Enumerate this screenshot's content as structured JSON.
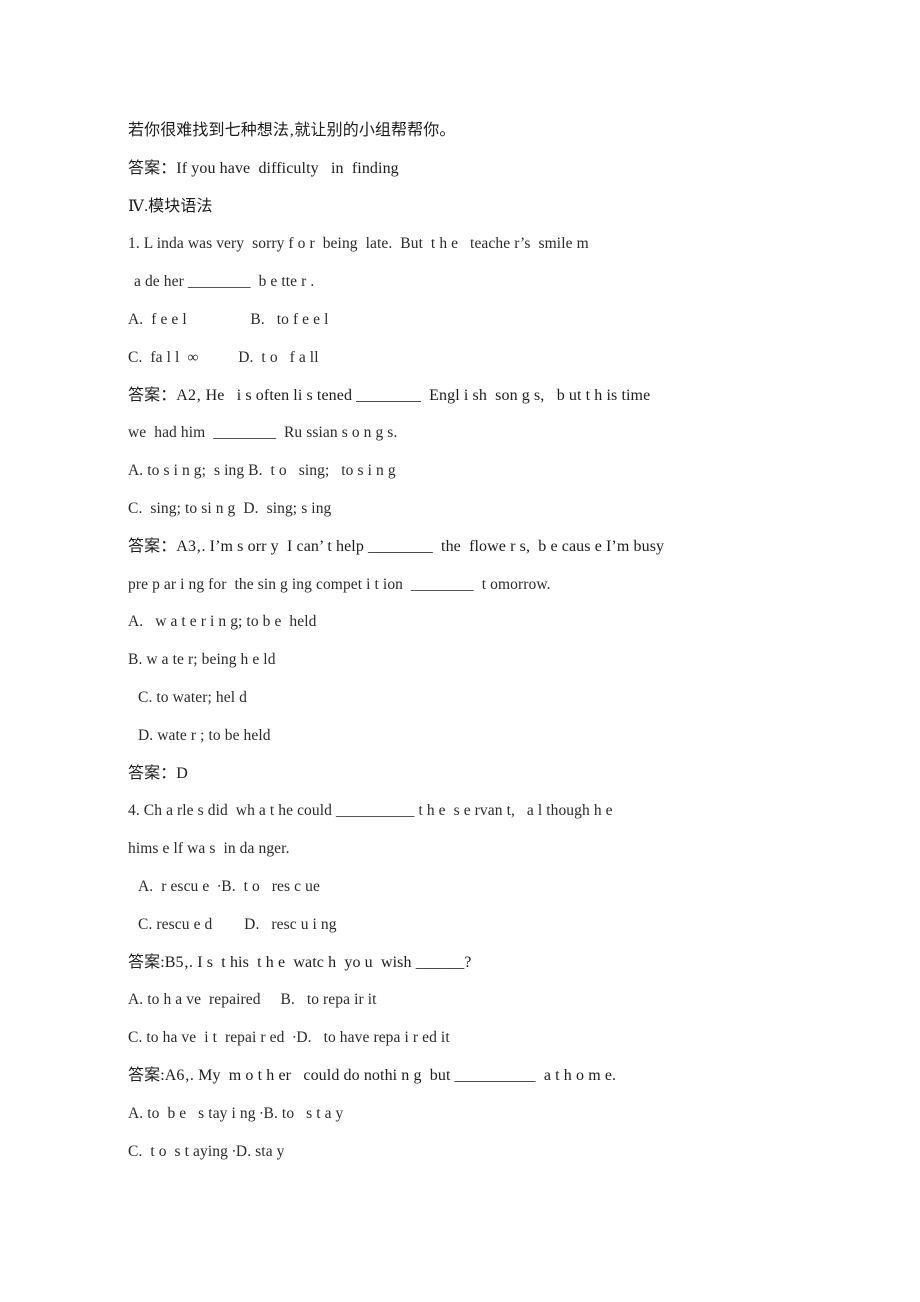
{
  "document": {
    "page_background": "#ffffff",
    "text_color": "#262626",
    "lines": [
      {
        "id": "l1",
        "lang": "cn",
        "text": "若你很难找到七种想法‚就让别的小组帮帮你。"
      },
      {
        "id": "l2",
        "lang": "cn",
        "text": "答案：If you have  difficulty   in  finding"
      },
      {
        "id": "l3",
        "lang": "cn",
        "text": "Ⅳ.模块语法"
      },
      {
        "id": "l4",
        "lang": "en",
        "text": "1. L inda was very  sorry f o r  being  late.  But  t h e   teache r’s  smile m"
      },
      {
        "id": "l5",
        "lang": "en",
        "indent": true,
        "text": "a de her ________  b e tte r ."
      },
      {
        "id": "l6",
        "lang": "en",
        "text": "A.  f e e l                B.   to f e e l"
      },
      {
        "id": "l7",
        "lang": "en",
        "text": "C.  fa l l  ∞          D.  t o   f a ll"
      },
      {
        "id": "l8",
        "lang": "cn",
        "text": "答案：A2‚ He   i s often li s tened ________  Engl i sh  son g s,   b ut t h is time"
      },
      {
        "id": "l9",
        "lang": "en",
        "text": "we  had him  ________  Ru ssian s o n g s."
      },
      {
        "id": "l10",
        "lang": "en",
        "text": "A. to s i n g;  s ing B.  t o   sing;   to s i n g"
      },
      {
        "id": "l11",
        "lang": "en",
        "text": "C.  sing; to si n g  D.  sing; s ing"
      },
      {
        "id": "l12",
        "lang": "cn",
        "text": "答案：A3‚. I’m s orr y  I can’ t help ________  the  flowe r s,  b e caus e I’m busy"
      },
      {
        "id": "l13",
        "lang": "en",
        "text": "pre p ar i ng for  the sin g ing compet i t ion  ________  t omorrow."
      },
      {
        "id": "l14",
        "lang": "en",
        "text": "A.   w a t e r i n g; to b e  held"
      },
      {
        "id": "l15",
        "lang": "en",
        "text": "B. w a te r; being h e ld"
      },
      {
        "id": "l16",
        "lang": "en",
        "indent_sm": true,
        "text": "C. to water; hel d"
      },
      {
        "id": "l17",
        "lang": "en",
        "indent_sm": true,
        "text": "D. wate r ; to be held"
      },
      {
        "id": "l18",
        "lang": "cn",
        "text": "答案：D"
      },
      {
        "id": "l19",
        "lang": "en",
        "text": "4. Ch a rle s did  wh a t he could __________ t h e  s e rvan t,   a l though h e"
      },
      {
        "id": "l20",
        "lang": "en",
        "text": "hims e lf wa s  in da nger."
      },
      {
        "id": "l21",
        "lang": "en",
        "indent_sm": true,
        "text": "A.  r escu e  ∙B.  t o   res c ue"
      },
      {
        "id": "l22",
        "lang": "en",
        "indent_sm": true,
        "text": "C. rescu e d        D.   resc u i ng"
      },
      {
        "id": "l23",
        "lang": "cn",
        "text": "答案:B5‚. I s  t his  t h e  watc h  yo u  wish ______?"
      },
      {
        "id": "l24",
        "lang": "en",
        "text": "A. to h a ve  repaired     B.   to repa ir it"
      },
      {
        "id": "l25",
        "lang": "en",
        "text": "C. to ha ve  i t  repai r ed  ∙D.   to have repa i r ed it"
      },
      {
        "id": "l26",
        "lang": "cn",
        "text": "答案:A6‚. My  m o t h er   could do nothi n g  but __________  a t h o m e."
      },
      {
        "id": "l27",
        "lang": "en",
        "text": "A. to  b e   s tay i ng ∙B. to   s t a y"
      },
      {
        "id": "l28",
        "lang": "en",
        "text": "C.  t o  s t aying ∙D. sta y"
      }
    ]
  }
}
